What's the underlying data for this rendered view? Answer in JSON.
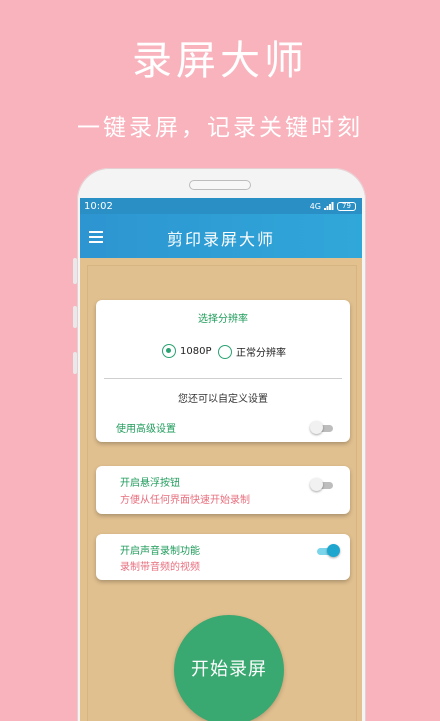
{
  "hero": {
    "title": "录屏大师",
    "subtitle": "一键录屏，记录关键时刻"
  },
  "status_bar": {
    "time": "10:02",
    "network": "4G",
    "battery": "79"
  },
  "app_bar": {
    "menu_icon": "hamburger-menu-icon",
    "title": "剪印录屏大师"
  },
  "resolution_card": {
    "heading": "选择分辨率",
    "options": [
      {
        "label": "1080P",
        "selected": true
      },
      {
        "label": "正常分辨率",
        "selected": false
      }
    ],
    "custom_hint": "您还可以自定义设置",
    "advanced_label": "使用高级设置",
    "advanced_enabled": false
  },
  "floating_card": {
    "title": "开启悬浮按钮",
    "description": "方便从任何界面快速开始录制",
    "enabled": false
  },
  "audio_card": {
    "title": "开启声音录制功能",
    "description": "录制带音频的视频",
    "enabled": true
  },
  "start_button": {
    "label": "开始录屏"
  },
  "colors": {
    "background": "#f9b3bd",
    "app_bar": "#2d95d1",
    "content_bg": "#e1c08f",
    "accent_green": "#1f9c5b",
    "accent_pink": "#e76f7e",
    "start_button": "#3aa871",
    "toggle_on": "#1ea6cf"
  }
}
